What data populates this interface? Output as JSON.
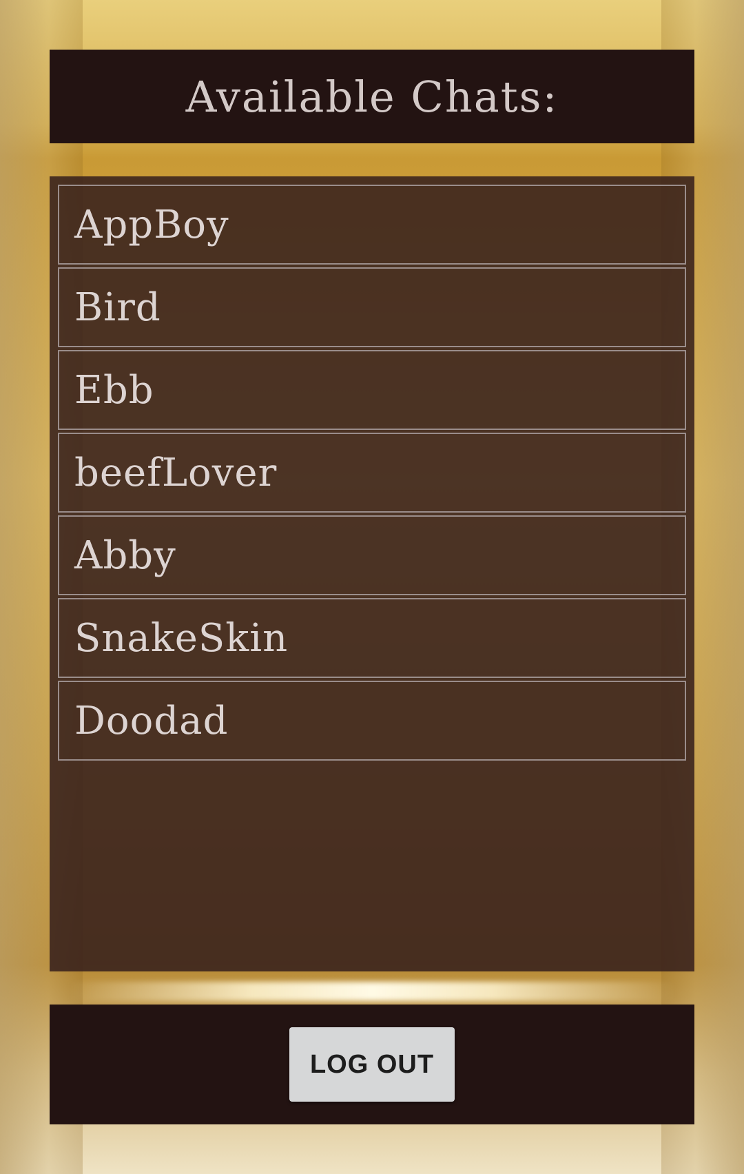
{
  "header": {
    "title": "Available Chats:"
  },
  "chats": [
    {
      "name": "AppBoy"
    },
    {
      "name": "Bird"
    },
    {
      "name": "Ebb"
    },
    {
      "name": "beefLover"
    },
    {
      "name": "Abby"
    },
    {
      "name": "SnakeSkin"
    },
    {
      "name": "Doodad"
    }
  ],
  "footer": {
    "logout_label": "LOG OUT"
  },
  "colors": {
    "panel_dark": "#231312",
    "list_background": "#341e1c",
    "text_light": "#d3c9c7",
    "button_background": "#d6d7d8"
  }
}
